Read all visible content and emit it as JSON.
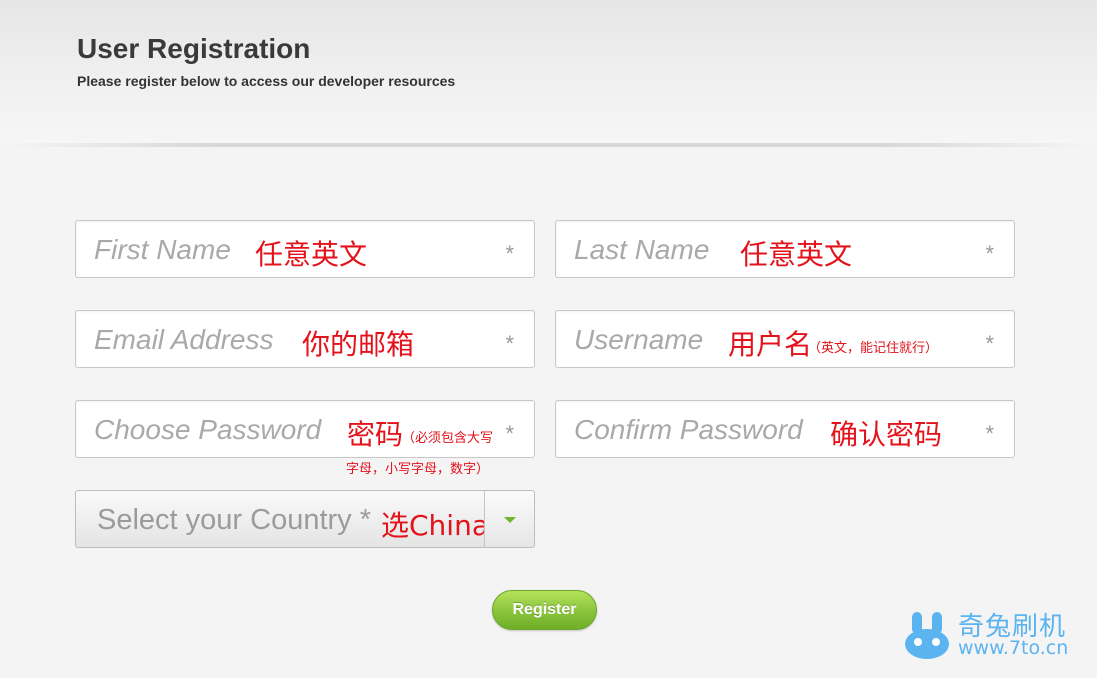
{
  "header": {
    "title": "User Registration",
    "subtitle": "Please register below to access our developer resources"
  },
  "form": {
    "first_name": {
      "placeholder": "First Name",
      "annotation": "任意英文",
      "required": "*"
    },
    "last_name": {
      "placeholder": "Last Name",
      "annotation": "任意英文",
      "required": "*"
    },
    "email": {
      "placeholder": "Email Address",
      "annotation": "你的邮箱",
      "required": "*"
    },
    "username": {
      "placeholder": "Username",
      "annotation": "用户名",
      "annotation_note": "（英文，能记住就行）",
      "required": "*"
    },
    "password": {
      "placeholder": "Choose Password",
      "annotation": "密码",
      "annotation_note_1": "（必须包含大写",
      "annotation_note_2": "字母，小写字母，数字）",
      "required": "*"
    },
    "confirm_password": {
      "placeholder": "Confirm Password",
      "annotation": "确认密码",
      "required": "*"
    },
    "country": {
      "value": "Select your Country *",
      "annotation": "选China",
      "arrow_icon": "chevron-down-icon"
    },
    "register_label": "Register"
  },
  "watermark": {
    "name": "奇兔刷机",
    "url": "www.7to.cn",
    "logo_icon": "rabbit-logo-icon"
  },
  "colors": {
    "annotation": "#e3121b",
    "register_button": "#8cc63f",
    "watermark": "#5bb4f0"
  }
}
